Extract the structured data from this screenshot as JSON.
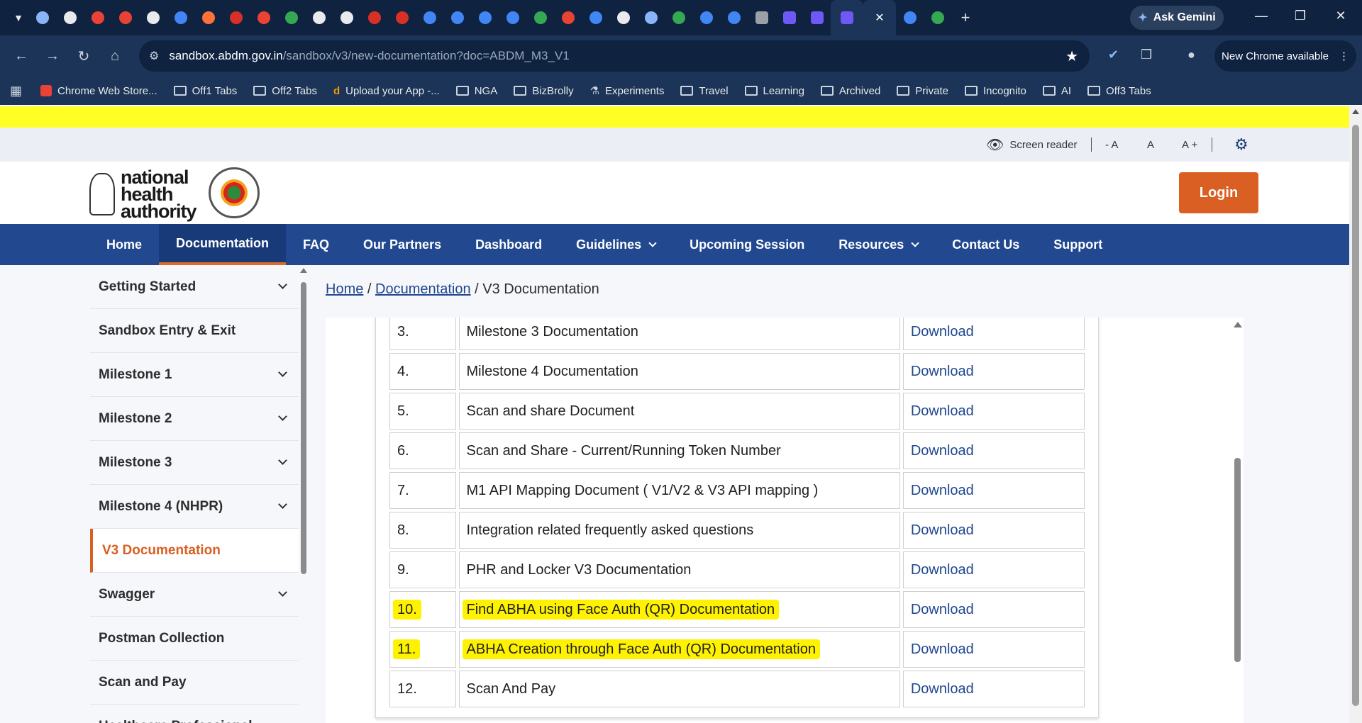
{
  "browser": {
    "tab_colors": [
      "#8ab4f8",
      "#e8eaed",
      "#ea4335",
      "#e94235",
      "#e8eaed",
      "#4285f4",
      "#ff7139",
      "#d93025",
      "#ea4335",
      "#34a853",
      "#e8eaed",
      "#e8eaed",
      "#d93025",
      "#d93025",
      "#4285f4",
      "#4285f4",
      "#4285f4",
      "#4285f4",
      "#34a853",
      "#ea4335",
      "#4285f4",
      "#e8eaed",
      "#8ab4f8",
      "#34a853",
      "#4285f4",
      "#4285f4",
      "#9aa0a6",
      "#6e59f7",
      "#6e59f7",
      "#6e59f7"
    ],
    "new_tab": "+",
    "ask_gemini": "Ask Gemini",
    "url_domain": "sandbox.abdm.gov.in",
    "url_path": "/sandbox/v3/new-documentation?doc=ABDM_M3_V1",
    "new_chrome": "New Chrome available",
    "bookmarks": [
      {
        "label": "Chrome Web Store...",
        "icon": "chrome-store-icon"
      },
      {
        "label": "Off1 Tabs",
        "icon": "folder-icon"
      },
      {
        "label": "Off2 Tabs",
        "icon": "folder-icon"
      },
      {
        "label": "Upload your App -...",
        "icon": "d-icon"
      },
      {
        "label": "NGA",
        "icon": "folder-icon"
      },
      {
        "label": "BizBrolly",
        "icon": "folder-icon"
      },
      {
        "label": "Experiments",
        "icon": "flask-icon"
      },
      {
        "label": "Travel",
        "icon": "folder-icon"
      },
      {
        "label": "Learning",
        "icon": "folder-icon"
      },
      {
        "label": "Archived",
        "icon": "folder-icon"
      },
      {
        "label": "Private",
        "icon": "folder-icon"
      },
      {
        "label": "Incognito",
        "icon": "folder-icon"
      },
      {
        "label": "AI",
        "icon": "folder-icon"
      },
      {
        "label": "Off3 Tabs",
        "icon": "folder-icon"
      }
    ]
  },
  "accessibility": {
    "screen_reader": "Screen reader",
    "font_decrease": "- A",
    "font_normal": "A",
    "font_increase": "A +"
  },
  "header": {
    "logo_text_1": "national",
    "logo_text_2": "health",
    "logo_text_3": "authority",
    "login": "Login"
  },
  "nav": {
    "items": [
      "Home",
      "Documentation",
      "FAQ",
      "Our Partners",
      "Dashboard",
      "Guidelines",
      "Upcoming Session",
      "Resources",
      "Contact Us",
      "Support"
    ]
  },
  "sidebar": {
    "items": [
      "Getting Started",
      "Sandbox Entry & Exit",
      "Milestone 1",
      "Milestone 2",
      "Milestone 3",
      "Milestone 4 (NHPR)",
      "V3 Documentation",
      "Swagger",
      "Postman Collection",
      "Scan and Pay",
      "Healthcare Professional"
    ]
  },
  "breadcrumb": {
    "home": "Home",
    "sep": "/",
    "documentation": "Documentation",
    "current": "V3 Documentation"
  },
  "docs": {
    "rows": [
      {
        "num": "3.",
        "name": "Milestone 3 Documentation",
        "link": "Download"
      },
      {
        "num": "4.",
        "name": "Milestone 4 Documentation",
        "link": "Download"
      },
      {
        "num": "5.",
        "name": "Scan and share Document",
        "link": "Download"
      },
      {
        "num": "6.",
        "name": "Scan and Share - Current/Running Token Number",
        "link": "Download"
      },
      {
        "num": "7.",
        "name": "M1 API Mapping Document ( V1/V2 & V3 API mapping )",
        "link": "Download"
      },
      {
        "num": "8.",
        "name": "Integration related frequently asked questions",
        "link": "Download"
      },
      {
        "num": "9.",
        "name": "PHR and Locker V3 Documentation",
        "link": "Download"
      },
      {
        "num": "10.",
        "name": "Find ABHA using Face Auth (QR) Documentation",
        "link": "Download"
      },
      {
        "num": "11.",
        "name": "ABHA Creation through Face Auth (QR) Documentation",
        "link": "Download"
      },
      {
        "num": "12.",
        "name": "Scan And Pay",
        "link": "Download"
      }
    ]
  }
}
